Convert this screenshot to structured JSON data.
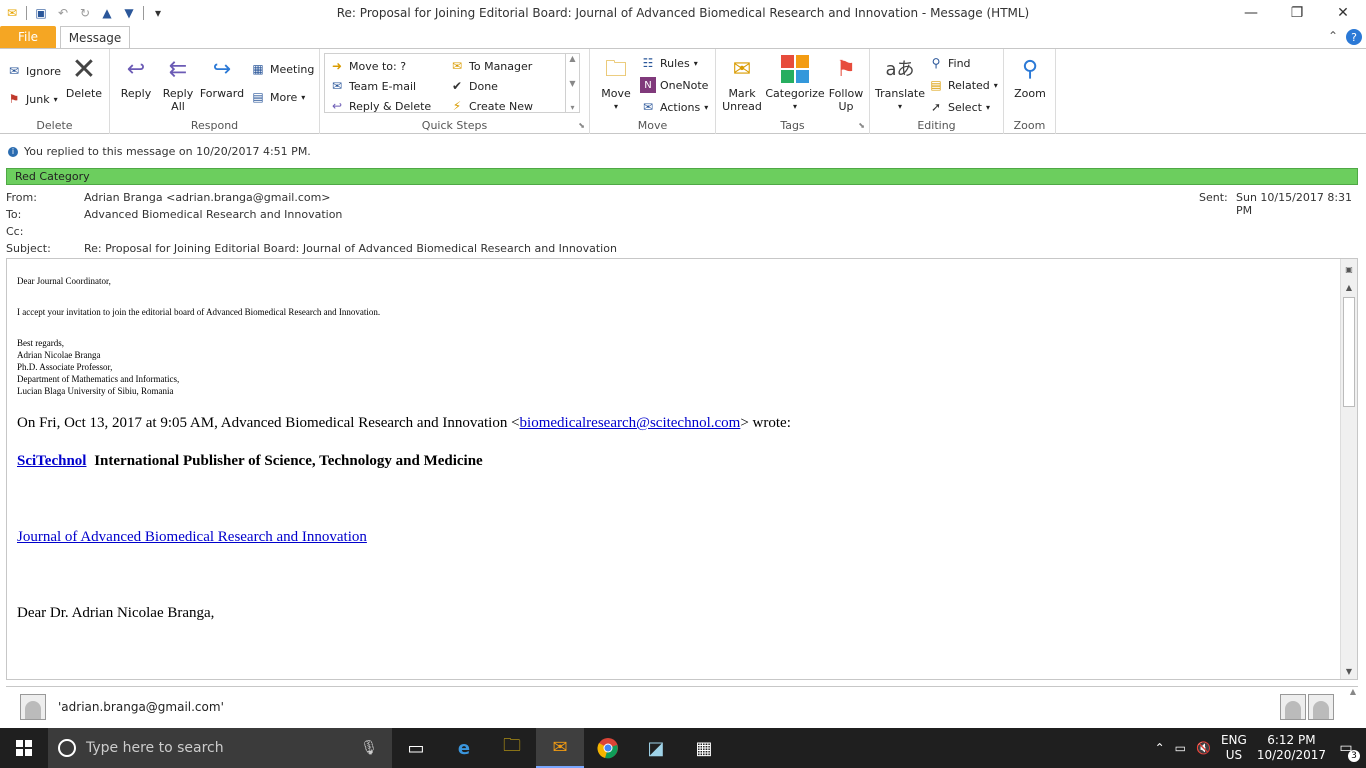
{
  "window": {
    "title": "Re: Proposal for Joining Editorial Board: Journal of Advanced Biomedical Research and Innovation  -  Message (HTML)"
  },
  "tabs": {
    "file": "File",
    "message": "Message"
  },
  "ribbon": {
    "delete": {
      "ignore": "Ignore",
      "junk": "Junk",
      "delete": "Delete",
      "label": "Delete"
    },
    "respond": {
      "reply": "Reply",
      "reply_all_1": "Reply",
      "reply_all_2": "All",
      "forward": "Forward",
      "meeting": "Meeting",
      "more": "More",
      "label": "Respond"
    },
    "quick_steps": {
      "items": [
        "Move to: ?",
        "To Manager",
        "Team E-mail",
        "Done",
        "Reply & Delete",
        "Create New"
      ],
      "label": "Quick Steps"
    },
    "move": {
      "move": "Move",
      "rules": "Rules",
      "onenote": "OneNote",
      "actions": "Actions",
      "label": "Move"
    },
    "tags": {
      "mark_1": "Mark",
      "mark_2": "Unread",
      "categorize": "Categorize",
      "follow_1": "Follow",
      "follow_2": "Up",
      "label": "Tags"
    },
    "editing": {
      "translate": "Translate",
      "find": "Find",
      "related": "Related",
      "select": "Select",
      "label": "Editing"
    },
    "zoom": {
      "zoom": "Zoom",
      "label": "Zoom"
    }
  },
  "message": {
    "info": "You replied to this message on 10/20/2017 4:51 PM.",
    "category": "Red Category",
    "from_label": "From:",
    "from": "Adrian Branga <adrian.branga@gmail.com>",
    "to_label": "To:",
    "to": "Advanced Biomedical Research and Innovation",
    "cc_label": "Cc:",
    "subject_label": "Subject:",
    "subject": "Re: Proposal for Joining Editorial Board: Journal of Advanced Biomedical Research and Innovation",
    "sent_label": "Sent:",
    "sent": "Sun 10/15/2017 8:31 PM"
  },
  "body": {
    "greeting": "Dear Journal Coordinator,",
    "line1": "I accept your invitation to join the editorial board of Advanced Biomedical Research and Innovation.",
    "sig": [
      "Best regards,",
      "Adrian Nicolae Branga",
      "Ph.D. Associate Professor,",
      "Department of Mathematics and Informatics,",
      "Lucian Blaga University of Sibiu, Romania"
    ],
    "quote_prefix": "On Fri, Oct 13, 2017 at 9:05 AM, Advanced Biomedical Research and Innovation <",
    "quote_email": "biomedicalresearch@scitechnol.com",
    "quote_suffix": "> wrote:",
    "brand_link": "SciTechnol",
    "brand_tagline": "International Publisher of Science, Technology and Medicine",
    "journal_link": "Journal of Advanced Biomedical Research and Innovation",
    "dear": "Dear Dr. Adrian Nicolae Branga,"
  },
  "people": {
    "name": "'adrian.branga@gmail.com'"
  },
  "taskbar": {
    "search_placeholder": "Type here to search",
    "lang1": "ENG",
    "lang2": "US",
    "time": "6:12 PM",
    "date": "10/20/2017",
    "notifications": "3"
  },
  "colors": {
    "accent": "#2b579a",
    "file_tab": "#f5a623",
    "category": "#6cce5e"
  }
}
